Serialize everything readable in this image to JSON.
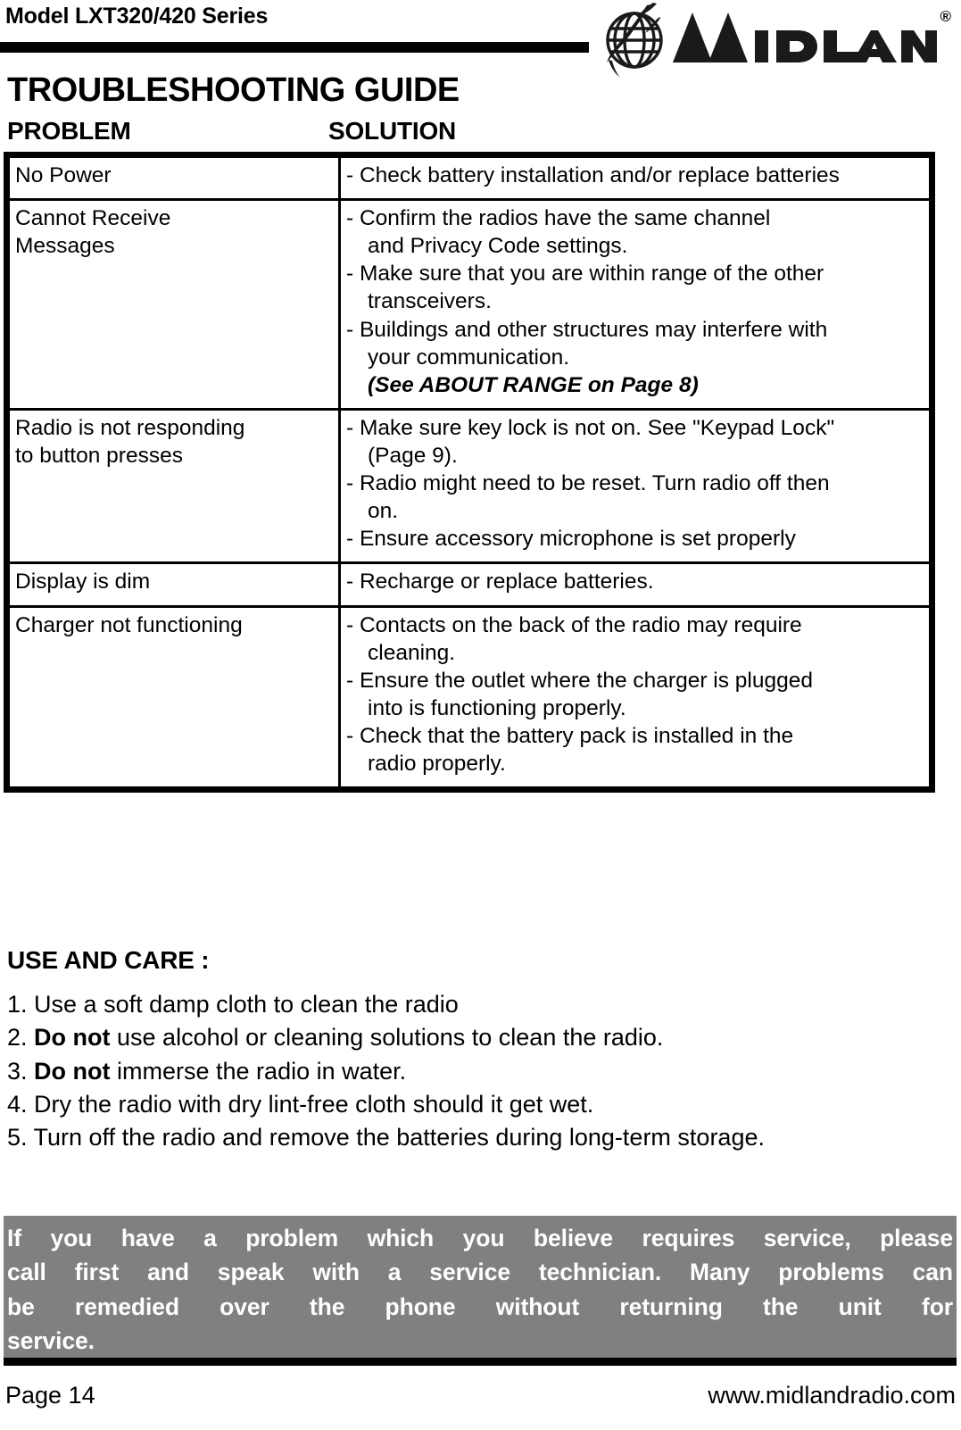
{
  "header": {
    "model": "Model LXT320/420 Series",
    "logo": {
      "wordmark": "MIDLAND",
      "registered": "®",
      "globe_icon": "globe-icon"
    }
  },
  "title": "TROUBLESHOOTING GUIDE",
  "columns": {
    "problem": "PROBLEM",
    "solution": "SOLUTION"
  },
  "table": {
    "rows": [
      {
        "problem": [
          "No Power"
        ],
        "solution": [
          {
            "bullet": "-",
            "lines": [
              "Check battery installation and/or replace batteries"
            ]
          }
        ]
      },
      {
        "problem": [
          "Cannot Receive",
          "Messages"
        ],
        "solution": [
          {
            "bullet": "-",
            "lines": [
              "Confirm the radios have the same channel",
              "and Privacy Code settings."
            ]
          },
          {
            "bullet": "-",
            "lines": [
              "Make sure that you are within range of the other",
              "transceivers."
            ]
          },
          {
            "bullet": "-",
            "lines": [
              "Buildings and other structures may interfere with",
              "your communication."
            ]
          }
        ],
        "note": "(See ABOUT RANGE on Page 8)"
      },
      {
        "problem": [
          "Radio is not responding",
          "to button presses"
        ],
        "solution": [
          {
            "bullet": "-",
            "lines": [
              "Make sure key lock is not on. See \"Keypad Lock\"",
              "(Page 9)."
            ]
          },
          {
            "bullet": "-",
            "lines": [
              "Radio might need to be reset.  Turn radio off then",
              "on."
            ]
          },
          {
            "bullet": "-",
            "lines": [
              "Ensure accessory microphone is set properly"
            ]
          }
        ]
      },
      {
        "problem": [
          "Display is dim"
        ],
        "solution": [
          {
            "bullet": "-",
            "lines": [
              "Recharge or replace batteries."
            ]
          }
        ]
      },
      {
        "problem": [
          "Charger not functioning"
        ],
        "solution": [
          {
            "bullet": "-",
            "lines": [
              "Contacts on the back of the radio may require",
              "cleaning."
            ]
          },
          {
            "bullet": "-",
            "lines": [
              "Ensure the outlet where the charger is plugged",
              "into is functioning properly."
            ]
          },
          {
            "bullet": "-",
            "lines": [
              "Check that the battery pack is installed in the",
              "radio properly."
            ]
          }
        ]
      }
    ]
  },
  "use_and_care": {
    "heading": "USE AND CARE :",
    "items": [
      {
        "number": "1.",
        "bold": "",
        "text": "Use a soft damp cloth to clean the radio"
      },
      {
        "number": "2.",
        "bold": "Do not",
        "text": "use alcohol or cleaning solutions to clean the radio."
      },
      {
        "number": "3.",
        "bold": "Do not",
        "text": "immerse the radio in water."
      },
      {
        "number": "4.",
        "bold": "",
        "text": "Dry the radio with dry lint-free cloth should it get wet."
      },
      {
        "number": "5.",
        "bold": "",
        "text": "Turn off the radio and remove the batteries during long-term storage."
      }
    ]
  },
  "notice": {
    "lines": [
      "If you have a problem which you believe requires service, please",
      "call first and speak with a service technician.  Many problems can",
      "be remedied over the phone without returning the unit for",
      "service."
    ],
    "background": "#808080",
    "text_color": "#ffffff"
  },
  "footer": {
    "page": "Page 14",
    "url": "www.midlandradio.com"
  }
}
